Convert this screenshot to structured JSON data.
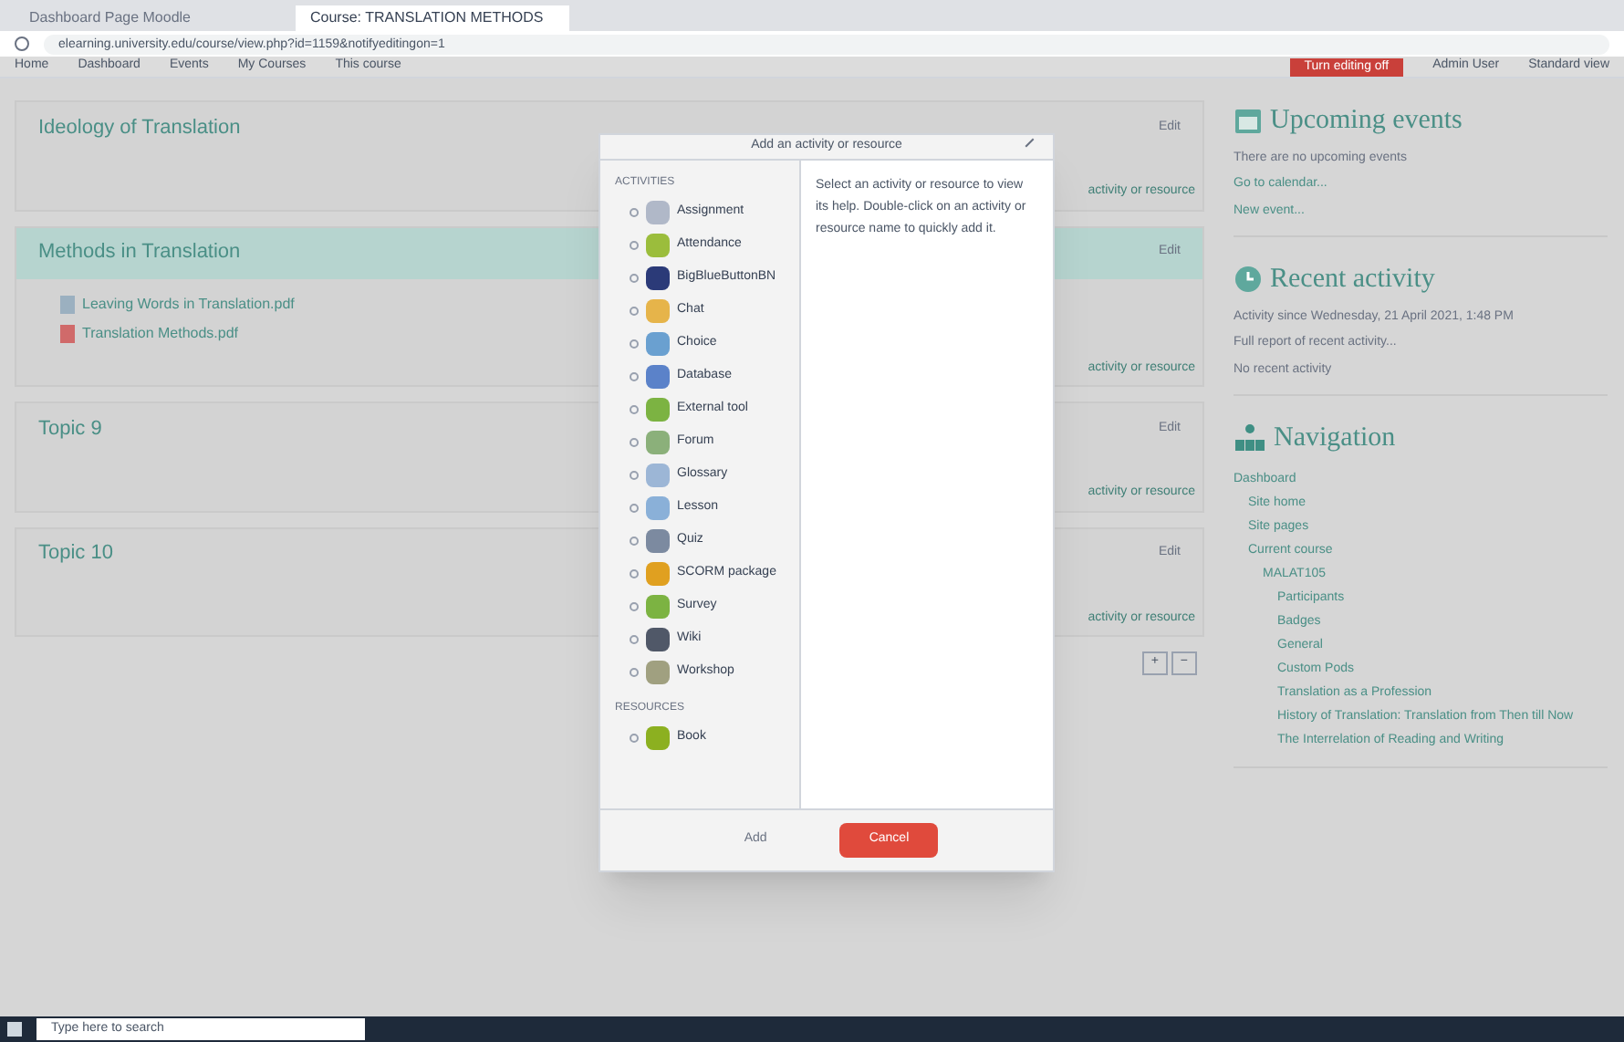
{
  "browser": {
    "tabs": [
      {
        "title": "Dashboard Page Moodle",
        "selected": false
      },
      {
        "title": "Course: TRANSLATION METHODS",
        "selected": true
      }
    ],
    "url": "elearning.university.edu/course/view.php?id=1159&notifyeditingon=1",
    "bookmarks": [
      "Home",
      "Dashboard",
      "Events",
      "My Courses",
      "This course"
    ]
  },
  "header": {
    "editing_button": "Turn editing off",
    "user": "Admin User",
    "edit_link": "Standard view"
  },
  "sections": [
    {
      "title": "Ideology of Translation",
      "highlighted": false,
      "add_link": "activity or resource",
      "edit": "Edit"
    },
    {
      "title": "Methods in Translation",
      "highlighted": true,
      "items": [
        {
          "label": "Leaving Words in Translation.pdf",
          "kind": "file"
        },
        {
          "label": "Translation Methods.pdf",
          "kind": "pdf"
        }
      ],
      "add_link": "activity or resource",
      "edit": "Edit"
    },
    {
      "title": "Topic 9",
      "highlighted": false,
      "add_link": "activity or resource",
      "edit": "Edit"
    },
    {
      "title": "Topic 10",
      "highlighted": false,
      "add_link": "activity or resource",
      "edit": "Edit"
    }
  ],
  "pager": [
    "+",
    "−"
  ],
  "modal": {
    "title": "Add an activity or resource",
    "activities_heading": "ACTIVITIES",
    "activities": [
      {
        "label": "Assignment",
        "color": "#b0b8c8"
      },
      {
        "label": "Attendance",
        "color": "#9bbd3c"
      },
      {
        "label": "BigBlueButtonBN",
        "color": "#2b3a78"
      },
      {
        "label": "Chat",
        "color": "#e6b44a"
      },
      {
        "label": "Choice",
        "color": "#6aa0d0"
      },
      {
        "label": "Database",
        "color": "#5b82c9"
      },
      {
        "label": "External tool",
        "color": "#7cb342"
      },
      {
        "label": "Forum",
        "color": "#8bb07a"
      },
      {
        "label": "Glossary",
        "color": "#9cb6d6"
      },
      {
        "label": "Lesson",
        "color": "#8ab0d8"
      },
      {
        "label": "Quiz",
        "color": "#7c8aa0"
      },
      {
        "label": "SCORM package",
        "color": "#e0a020"
      },
      {
        "label": "Survey",
        "color": "#7cb342"
      },
      {
        "label": "Wiki",
        "color": "#505868"
      },
      {
        "label": "Workshop",
        "color": "#a0a080"
      }
    ],
    "resources_heading": "RESOURCES",
    "resources": [
      {
        "label": "Book",
        "color": "#8cb020"
      }
    ],
    "help": "Select an activity or resource to view its help. Double-click on an activity or resource name to quickly add it.",
    "add": "Add",
    "cancel": "Cancel"
  },
  "sidebar": [
    {
      "kind": "events",
      "title": "Upcoming events",
      "lines": [
        "There are no upcoming events"
      ],
      "links": [
        "Go to calendar...",
        "New event..."
      ]
    },
    {
      "kind": "activity",
      "title": "Recent activity",
      "lines": [
        "Activity since Wednesday, 21 April 2021, 1:48 PM",
        "Full report of recent activity...",
        "No recent activity"
      ]
    },
    {
      "kind": "navigation",
      "title": "Navigation",
      "tree": [
        {
          "label": "Dashboard",
          "children": [
            {
              "label": "Site home"
            },
            {
              "label": "Site pages"
            },
            {
              "label": "Current course",
              "children": [
                {
                  "label": "MALAT105",
                  "children": [
                    {
                      "label": "Participants"
                    },
                    {
                      "label": "Badges"
                    },
                    {
                      "label": "General"
                    },
                    {
                      "label": "Custom Pods"
                    },
                    {
                      "label": "Translation as a Profession"
                    },
                    {
                      "label": "History of Translation: Translation from Then till Now"
                    },
                    {
                      "label": "The Interrelation of Reading and Writing"
                    }
                  ]
                }
              ]
            }
          ]
        }
      ]
    }
  ],
  "taskbar": {
    "search_placeholder": "Type here to search"
  }
}
